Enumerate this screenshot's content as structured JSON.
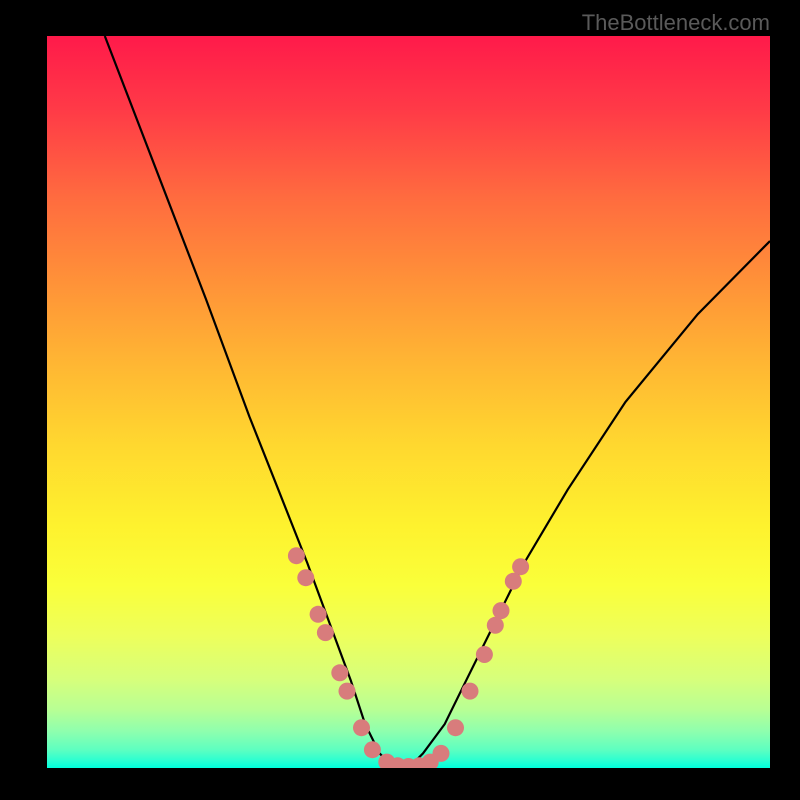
{
  "watermark": "TheBottleneck.com",
  "chart_data": {
    "type": "line",
    "title": "",
    "xlabel": "",
    "ylabel": "",
    "xlim": [
      0,
      100
    ],
    "ylim": [
      0,
      100
    ],
    "series": [
      {
        "name": "bottleneck-curve",
        "x": [
          8,
          15,
          22,
          28,
          32,
          36,
          39,
          42,
          44,
          46,
          48,
          50,
          52,
          55,
          58,
          62,
          66,
          72,
          80,
          90,
          100
        ],
        "y": [
          100,
          82,
          64,
          48,
          38,
          28,
          20,
          12,
          6,
          2,
          0,
          0,
          2,
          6,
          12,
          20,
          28,
          38,
          50,
          62,
          72
        ]
      }
    ],
    "markers": {
      "name": "data-points",
      "color": "#d87c7c",
      "points": [
        {
          "x": 34.5,
          "y": 29
        },
        {
          "x": 35.8,
          "y": 26
        },
        {
          "x": 37.5,
          "y": 21
        },
        {
          "x": 38.5,
          "y": 18.5
        },
        {
          "x": 40.5,
          "y": 13
        },
        {
          "x": 41.5,
          "y": 10.5
        },
        {
          "x": 43.5,
          "y": 5.5
        },
        {
          "x": 45.0,
          "y": 2.5
        },
        {
          "x": 47.0,
          "y": 0.8
        },
        {
          "x": 48.5,
          "y": 0.3
        },
        {
          "x": 50.0,
          "y": 0.2
        },
        {
          "x": 51.5,
          "y": 0.3
        },
        {
          "x": 53.0,
          "y": 0.8
        },
        {
          "x": 54.5,
          "y": 2.0
        },
        {
          "x": 56.5,
          "y": 5.5
        },
        {
          "x": 58.5,
          "y": 10.5
        },
        {
          "x": 60.5,
          "y": 15.5
        },
        {
          "x": 62.0,
          "y": 19.5
        },
        {
          "x": 62.8,
          "y": 21.5
        },
        {
          "x": 64.5,
          "y": 25.5
        },
        {
          "x": 65.5,
          "y": 27.5
        }
      ]
    },
    "background_gradient": {
      "top": "#ff1a4a",
      "bottom": "#00ffdc"
    }
  }
}
